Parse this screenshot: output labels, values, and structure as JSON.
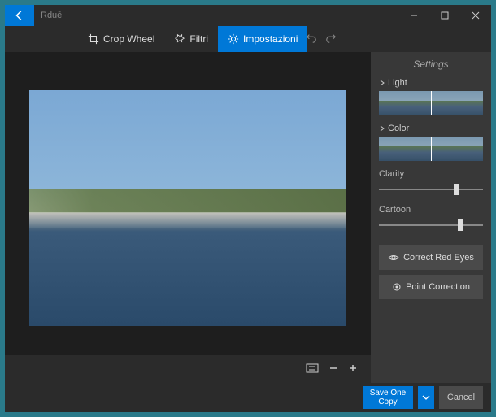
{
  "titlebar": {
    "app_name": "Rduē"
  },
  "toolbar": {
    "crop": "Crop Wheel",
    "filters": "Filtri",
    "settings": "Impostazioni"
  },
  "sidebar": {
    "title": "Settings",
    "light_label": "Light",
    "color_label": "Color",
    "clarity_label": "Clarity",
    "cartoon_label": "Cartoon",
    "clarity_value": 72,
    "cartoon_value": 76,
    "red_eyes": "Correct Red Eyes",
    "point_correction": "Point Correction"
  },
  "footer": {
    "save": "Save One Copy",
    "cancel": "Cancel"
  }
}
